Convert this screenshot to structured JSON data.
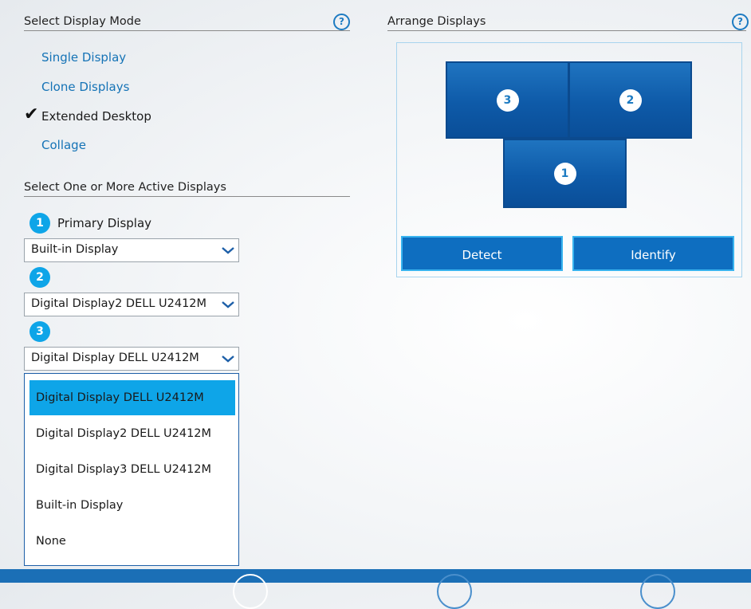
{
  "display_mode": {
    "title": "Select Display Mode",
    "options": [
      "Single Display",
      "Clone Displays",
      "Extended Desktop",
      "Collage"
    ],
    "selected": "Extended Desktop"
  },
  "active_displays": {
    "title": "Select One or More Active Displays",
    "primary_label": "Primary Display",
    "badges": [
      "1",
      "2",
      "3"
    ],
    "selects": [
      "Built-in Display",
      "Digital Display2 DELL U2412M",
      "Digital Display DELL U2412M"
    ],
    "dropdown_options": [
      "Digital Display DELL U2412M",
      "Digital Display2 DELL U2412M",
      "Digital Display3 DELL U2412M",
      "Built-in Display",
      "None"
    ],
    "dropdown_highlighted": "Digital Display DELL U2412M"
  },
  "arrange": {
    "title": "Arrange Displays",
    "monitors": [
      "3",
      "2",
      "1"
    ],
    "detect_label": "Detect",
    "identify_label": "Identify"
  },
  "help_icon_glyph": "?",
  "check_glyph": "✔",
  "colors": {
    "accent": "#0ea5e8",
    "link": "#1573b6",
    "button": "#0e6ec0",
    "bar": "#1b6fb6"
  }
}
